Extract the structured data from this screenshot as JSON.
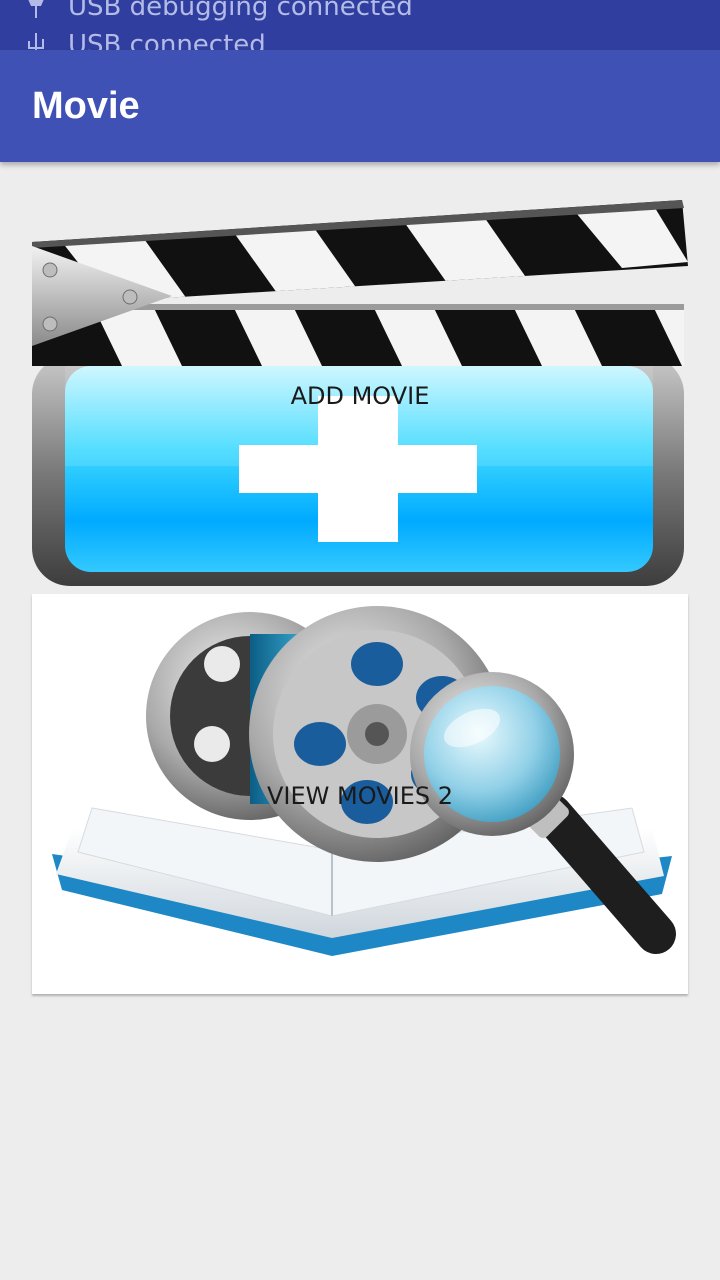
{
  "status_bar": {
    "notifications": [
      {
        "icon": "usb-debug-icon",
        "text": "USB debugging connected"
      },
      {
        "icon": "usb-icon",
        "text": "USB connected"
      }
    ]
  },
  "app_bar": {
    "title": "Movie",
    "color": "#3f51b5"
  },
  "main": {
    "add_movie": {
      "label": "ADD MOVIE",
      "image": "clapperboard-add-icon"
    },
    "view_movies": {
      "label": "VIEW MOVIES 2",
      "image": "film-reel-magnifier-icon"
    }
  }
}
